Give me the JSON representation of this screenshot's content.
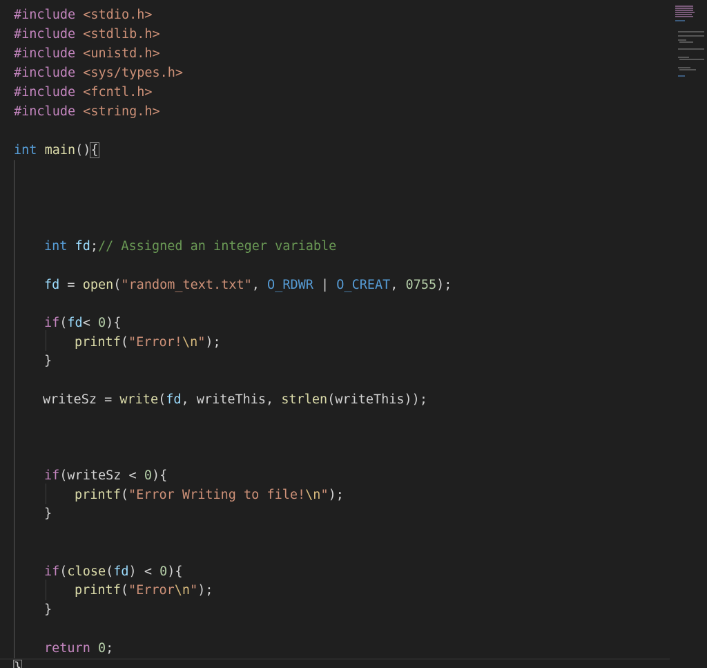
{
  "editor": {
    "language": "c",
    "includes": [
      "<stdio.h>",
      "<stdlib.h>",
      "<unistd.h>",
      "<sys/types.h>",
      "<fcntl.h>",
      "<string.h>"
    ],
    "include_directive": "#include",
    "main_sig": {
      "type": "int",
      "name": "main",
      "open": "()",
      "brace": "{"
    },
    "decl": {
      "type": "int",
      "var": "fd",
      "semi": ";",
      "comment": "// Assigned an integer variable"
    },
    "open_stmt": {
      "var": "fd",
      "eq": " = ",
      "fn": "open",
      "lp": "(",
      "arg1": "\"random_text.txt\"",
      "c1": ", ",
      "flag1": "O_RDWR",
      "pipe": " | ",
      "flag2": "O_CREAT",
      "c2": ", ",
      "mode": "0755",
      "end": ");"
    },
    "if1": {
      "kw": "if",
      "lp": "(",
      "var": "fd",
      "cond": "< ",
      "num": "0",
      "rp": "){",
      "print_fn": "printf",
      "print_lp": "(",
      "print_str": "\"Error!",
      "print_esc": "\\n",
      "print_str_end": "\"",
      "print_end": ");",
      "close": "}"
    },
    "write_stmt": {
      "lhs": "writeSz",
      "eq": " = ",
      "fn": "write",
      "lp": "(",
      "a1": "fd",
      "c1": ", ",
      "a2": "writeThis",
      "c2": ", ",
      "fn2": "strlen",
      "lp2": "(",
      "a3": "writeThis",
      "end": "));"
    },
    "if2": {
      "kw": "if",
      "lp": "(",
      "var": "writeSz",
      "cond": " < ",
      "num": "0",
      "rp": "){",
      "print_fn": "printf",
      "print_lp": "(",
      "print_str": "\"Error Writing to file!",
      "print_esc": "\\n",
      "print_str_end": "\"",
      "print_end": ");",
      "close": "}"
    },
    "if3": {
      "kw": "if",
      "lp": "(",
      "fn": "close",
      "lp2": "(",
      "var": "fd",
      "rp2": ")",
      "cond": " < ",
      "num": "0",
      "rp": "){",
      "print_fn": "printf",
      "print_lp": "(",
      "print_str": "\"Error",
      "print_esc": "\\n",
      "print_str_end": "\"",
      "print_end": ");",
      "close": "}"
    },
    "ret": {
      "kw": "return",
      "num": "0",
      "semi": ";"
    },
    "final_brace": "}"
  },
  "colors": {
    "background": "#1f1f1f",
    "preprocessor": "#c586c0",
    "type_keyword": "#569cd6",
    "string": "#ce9178",
    "comment": "#6a9955",
    "number": "#b5cea8",
    "function": "#dcdcaa",
    "variable": "#9cdcfe"
  }
}
